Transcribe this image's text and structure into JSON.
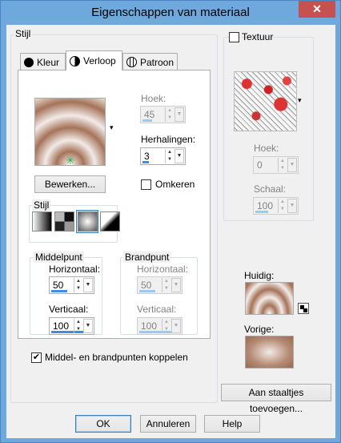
{
  "window": {
    "title": "Eigenschappen van materiaal",
    "close_glyph": "✕"
  },
  "stijl_group": {
    "label": "Stijl"
  },
  "tabs": [
    {
      "label": "Kleur",
      "icon": "black-circle-icon"
    },
    {
      "label": "Verloop",
      "icon": "half-circle-icon"
    },
    {
      "label": "Patroon",
      "icon": "globe-grid-icon"
    }
  ],
  "gradient": {
    "dropdown_glyph": "▾"
  },
  "hoek": {
    "label": "Hoek:",
    "value": "45"
  },
  "herhalingen": {
    "label": "Herhalingen:",
    "value": "3"
  },
  "bewerken": {
    "label": "Bewerken..."
  },
  "omkeren": {
    "label": "Omkeren",
    "checked": false
  },
  "stijl_inner": {
    "label": "Stijl"
  },
  "middelpunt": {
    "label": "Middelpunt",
    "horizontaal_label": "Horizontaal:",
    "horizontaal_value": "50",
    "verticaal_label": "Verticaal:",
    "verticaal_value": "100"
  },
  "brandpunt": {
    "label": "Brandpunt",
    "horizontaal_label": "Horizontaal:",
    "horizontaal_value": "50",
    "verticaal_label": "Verticaal:",
    "verticaal_value": "100"
  },
  "koppelen": {
    "label": "Middel- en brandpunten koppelen",
    "checked": true
  },
  "textuur": {
    "label": "Textuur",
    "checked": false,
    "hoek_label": "Hoek:",
    "hoek_value": "0",
    "schaal_label": "Schaal:",
    "schaal_value": "100"
  },
  "huidig": {
    "label": "Huidig:"
  },
  "vorige": {
    "label": "Vorige:"
  },
  "staaltjes": {
    "label": "Aan staaltjes toevoegen..."
  },
  "footer": {
    "ok": "OK",
    "annuleren": "Annuleren",
    "help": "Help"
  },
  "colors": {
    "titlebar": "#6fa8dc",
    "close": "#c75050",
    "accent": "#3d8ee0",
    "gradient_brown": "#9a6a50"
  }
}
